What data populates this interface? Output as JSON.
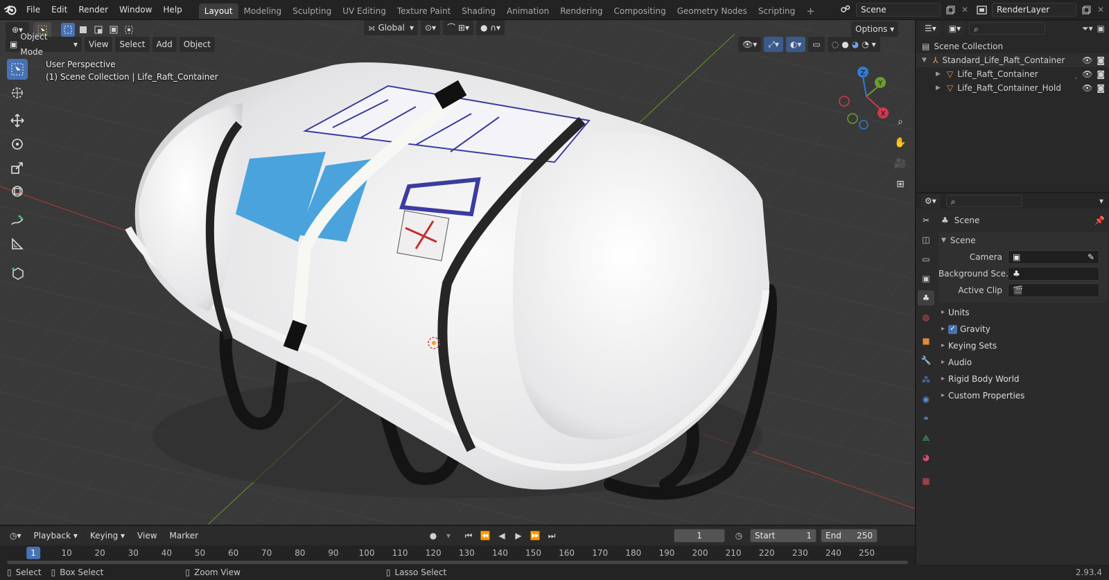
{
  "app": {
    "logo": "blender-logo-icon"
  },
  "menu": [
    "File",
    "Edit",
    "Render",
    "Window",
    "Help"
  ],
  "workspaces": [
    "Layout",
    "Modeling",
    "Sculpting",
    "UV Editing",
    "Texture Paint",
    "Shading",
    "Animation",
    "Rendering",
    "Compositing",
    "Geometry Nodes",
    "Scripting"
  ],
  "active_workspace": "Layout",
  "scene_field": "Scene",
  "view_layer_field": "RenderLayer",
  "viewport": {
    "transform_orientation": "Global",
    "options_label": "Options",
    "mode": "Object Mode",
    "menus": [
      "View",
      "Select",
      "Add",
      "Object"
    ],
    "overlay_title": "User Perspective",
    "overlay_subtitle": "(1) Scene Collection | Life_Raft_Container",
    "gizmo_axes": {
      "x": "X",
      "y": "Y",
      "z": "Z"
    }
  },
  "outliner": {
    "root": "Scene Collection",
    "items": [
      {
        "label": "Standard_Life_Raft_Container",
        "icon": "empty-object-icon"
      },
      {
        "label": "Life_Raft_Container",
        "icon": "mesh-triangle-icon"
      },
      {
        "label": "Life_Raft_Container_Hold",
        "icon": "mesh-triangle-icon"
      }
    ]
  },
  "properties": {
    "header_title": "Scene",
    "panel_title": "Scene",
    "fields": [
      {
        "label": "Camera",
        "value": ""
      },
      {
        "label": "Background Sce...",
        "value": ""
      },
      {
        "label": "Active Clip",
        "value": ""
      }
    ],
    "sections": [
      "Units",
      "Gravity",
      "Keying Sets",
      "Audio",
      "Rigid Body World",
      "Custom Properties"
    ],
    "gravity_checked": true
  },
  "timeline": {
    "menus": [
      "Playback",
      "Keying",
      "View",
      "Marker"
    ],
    "current_frame": "1",
    "start_label": "Start",
    "start": "1",
    "end_label": "End",
    "end": "250",
    "ruler": [
      "1",
      "10",
      "20",
      "30",
      "40",
      "50",
      "60",
      "70",
      "80",
      "90",
      "100",
      "110",
      "120",
      "130",
      "140",
      "150",
      "160",
      "170",
      "180",
      "190",
      "200",
      "210",
      "220",
      "230",
      "240",
      "250"
    ]
  },
  "statusbar": {
    "items": [
      "Select",
      "Box Select",
      "Zoom View",
      "Lasso Select"
    ],
    "version": "2.93.4"
  },
  "colors": {
    "accent": "#4772b3",
    "x_axis": "#d1384f",
    "y_axis": "#6c9c2e",
    "z_axis": "#2f7bd6"
  }
}
